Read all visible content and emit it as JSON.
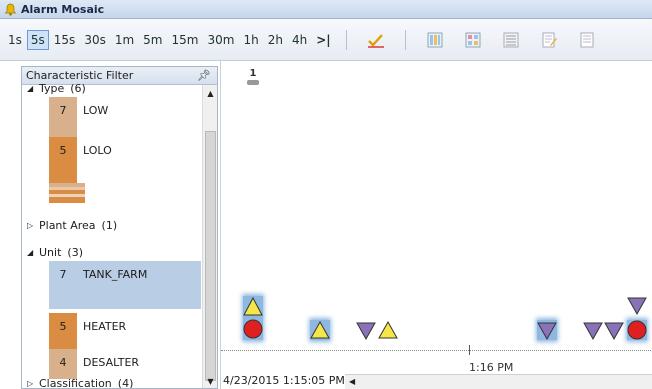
{
  "window": {
    "title": "Alarm Mosaic"
  },
  "toolbar": {
    "intervals": [
      "1s",
      "5s",
      "15s",
      "30s",
      "1m",
      "5m",
      "15m",
      "30m",
      "1h",
      "2h",
      "4h"
    ],
    "active_interval": "5s",
    "jump_latest_glyph": ">|"
  },
  "filter_panel": {
    "title": "Characteristic Filter",
    "groups": [
      {
        "label": "Type",
        "count": "(6)",
        "expanded": true,
        "items": [
          {
            "num": "7",
            "name": "LOW"
          },
          {
            "num": "5",
            "name": "LOLO"
          }
        ]
      },
      {
        "label": "Plant Area",
        "count": "(1)",
        "expanded": false
      },
      {
        "label": "Unit",
        "count": "(3)",
        "expanded": true,
        "items": [
          {
            "num": "7",
            "name": "TANK_FARM"
          },
          {
            "num": "5",
            "name": "HEATER"
          },
          {
            "num": "4",
            "name": "DESALTER"
          }
        ]
      },
      {
        "label": "Classification",
        "count": "(4)",
        "expanded": false
      }
    ]
  },
  "mosaic": {
    "column_badge": "1",
    "time_label": "1:16 PM",
    "timestamp": "4/23/2015 1:15:05 PM"
  },
  "colors": {
    "low": "#d8b08c",
    "lolo": "#d98c42",
    "tank_farm": "#b9cde4",
    "heater": "#d98c42",
    "desalter": "#d8b08c",
    "alarm_yellow": "#f5e64a",
    "alarm_purple": "#8a72b8",
    "alarm_red": "#e02020",
    "selected_glow": "#8fb8e0"
  }
}
